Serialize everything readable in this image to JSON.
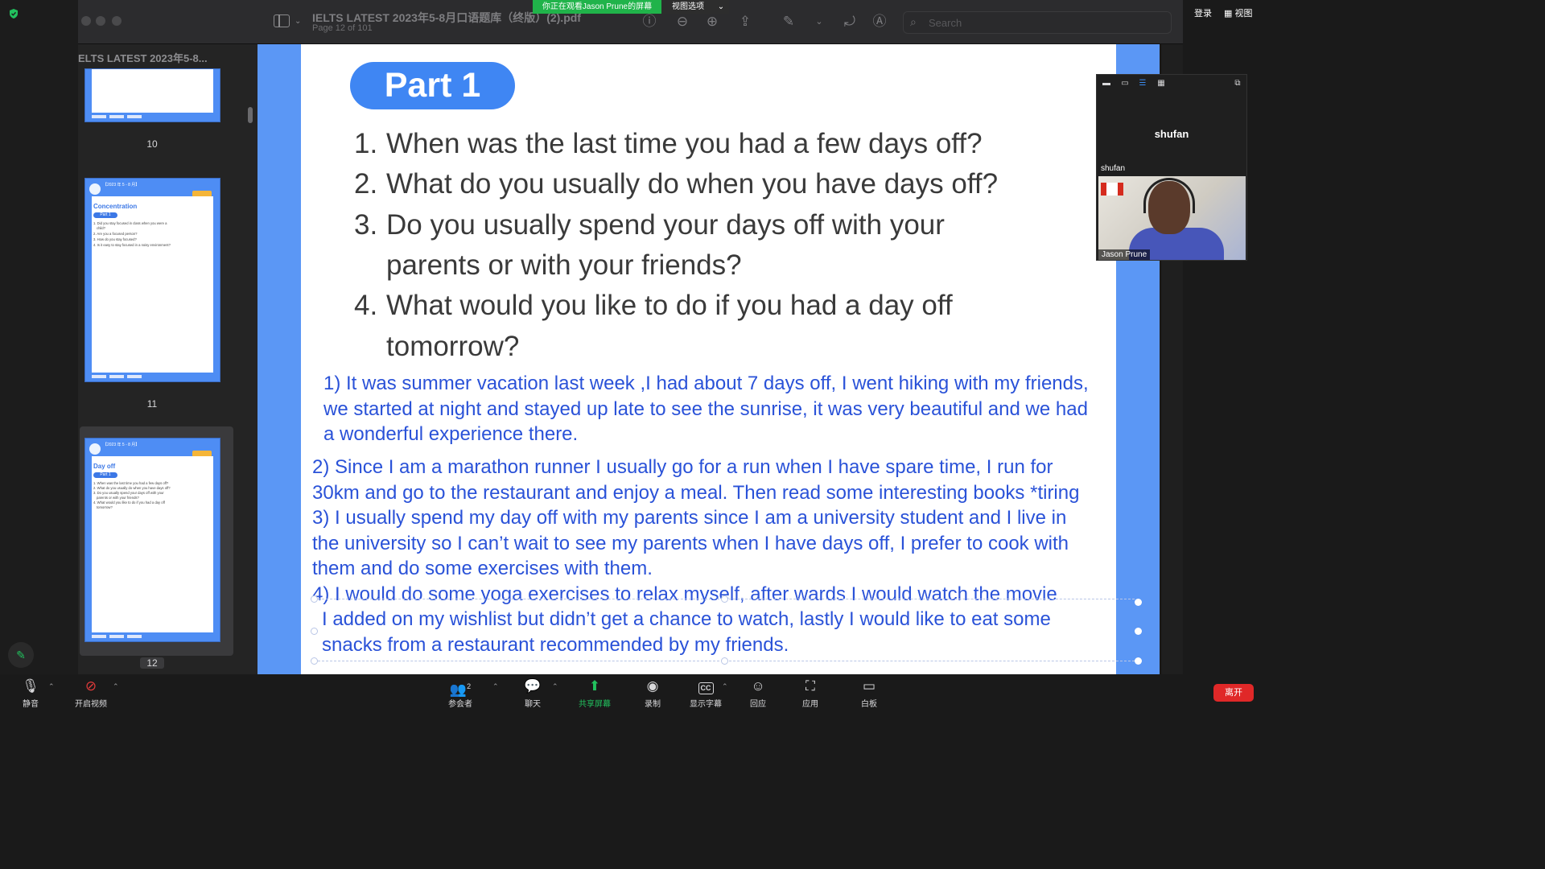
{
  "zoom": {
    "share_banner": "你正在观看Jason  Prune的屏幕",
    "view_options": "视图选项",
    "login": "登录",
    "view": "视图",
    "annotate_icon": "pencil-icon",
    "toolbar": {
      "mute": "静音",
      "video": "开启视频",
      "participants": "参会者",
      "participants_count": "2",
      "chat": "聊天",
      "share": "共享屏幕",
      "record": "录制",
      "captions": "显示字幕",
      "captions_icon_text": "CC",
      "reactions": "回应",
      "apps": "应用",
      "whiteboard": "白板",
      "leave": "离开"
    },
    "participants_panel": {
      "name_big": "shufan",
      "name_small": "shufan",
      "video_label": "Jason Prune"
    }
  },
  "pdf": {
    "doc_title": "IELTS LATEST 2023年5-8月口语题库（终版）(2).pdf",
    "page_info": "Page 12 of 101",
    "search_placeholder": "Search",
    "sidebar_title": "ELTS LATEST 2023年5-8...",
    "thumbnails": [
      {
        "number": "10"
      },
      {
        "number": "11",
        "heading": "Concentration",
        "part": "Part 1",
        "lines": [
          "1. Did you stay focused in class when you were a",
          "child?",
          "2. Are you a focused person?",
          "3. How do you stay focused?",
          "4. Is it easy to stay focused in a noisy environment?"
        ]
      },
      {
        "number": "12",
        "heading": "Day off",
        "part": "Part 1",
        "lines": [
          "1. When was the last time you had a few days off?",
          "2. What do you usually do when you have days off?",
          "3. Do you usually spend your days off with your",
          "parents or with your friends?",
          "4. What would you like to do if you had a day off",
          "tomorrow?"
        ]
      }
    ],
    "page": {
      "part_label": "Part 1",
      "questions": [
        {
          "num": "1.",
          "text": "When was the last time you had a few days off?"
        },
        {
          "num": "2.",
          "text": "What do you usually do when you have days off?"
        },
        {
          "num": "3.",
          "text": "Do you usually spend your days off with your"
        },
        {
          "num": "",
          "text": "parents or with your friends?"
        },
        {
          "num": "4.",
          "text": "What would you like to do if you had a day off"
        },
        {
          "num": "",
          "text": "tomorrow?"
        }
      ],
      "answers": [
        "1) It was summer vacation last week ,I had about 7 days off, I went hiking with my friends,",
        "we started at night and stayed up late to see the sunrise, it was very beautiful and we had",
        "a wonderful experience there.",
        "2) Since I am a marathon runner I usually go for a run when I have spare time, I run for",
        "30km and go to the restaurant and enjoy a meal.   Then read some interesting books   *tiring",
        "3) I usually spend my day off with my parents since I am a university student and I live in",
        "the university so I can’t wait to see my parents when I have days off, I prefer to cook with",
        "them and do some exercises with them.",
        "4) I would do some yoga exercises to relax myself, after   wards I would watch the movie",
        "I added on my wishlist but didn’t get a chance to watch, lastly I would like to eat some",
        "snacks from a restaurant recommended by my friends."
      ]
    }
  }
}
